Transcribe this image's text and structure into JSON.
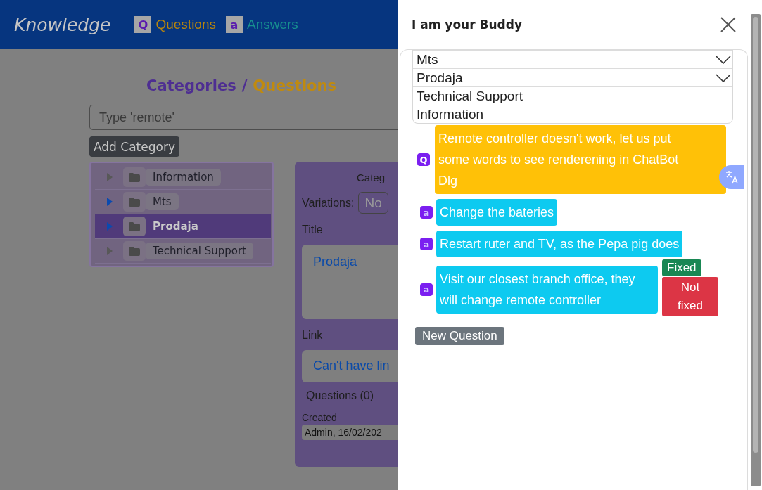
{
  "navbar": {
    "brand": "Knowledge",
    "links": [
      {
        "kind": "questions",
        "badge": "Q",
        "label": "Questions"
      },
      {
        "kind": "answers",
        "badge": "a",
        "label": "Answers"
      }
    ]
  },
  "page": {
    "title_part_1": "Categories",
    "title_separator": "/",
    "title_part_2": "Questions",
    "search": {
      "placeholder": "Type 'remote'"
    },
    "add_button": "Add Category",
    "tree": [
      {
        "label": "Information",
        "expandable": false,
        "selected": false
      },
      {
        "label": "Mts",
        "expandable": true,
        "selected": false
      },
      {
        "label": "Prodaja",
        "expandable": true,
        "selected": true
      },
      {
        "label": "Technical Support",
        "expandable": false,
        "selected": false
      }
    ],
    "detail": {
      "heading": "Categ",
      "variations_label": "Variations:",
      "variations_button": "No",
      "title_label": "Title",
      "title_value": "Prodaja",
      "link_label": "Link",
      "link_value": "Can't have lin",
      "questions_label": "Questions (0)",
      "created_label": "Created",
      "created_value": "Admin, 16/02/202"
    }
  },
  "buddy": {
    "title": "I am your Buddy",
    "categories": [
      {
        "label": "Mts",
        "expandable": true
      },
      {
        "label": "Prodaja",
        "expandable": true
      },
      {
        "label": "Technical Support",
        "expandable": false
      },
      {
        "label": "Information",
        "expandable": false
      }
    ],
    "messages": [
      {
        "kind": "question",
        "badge": "Q",
        "text": "Remote controller doesn't work, let us put some words to see renderening in ChatBot Dlg"
      },
      {
        "kind": "answer",
        "badge": "a",
        "text": "Change the bateries"
      },
      {
        "kind": "answer",
        "badge": "a",
        "text": "Restart ruter and TV, as the Pepa pig does"
      },
      {
        "kind": "answer",
        "badge": "a",
        "text": "Visit our closest branch office, they will change remote controller",
        "actions": [
          {
            "kind": "success",
            "label": "Fixed"
          },
          {
            "kind": "danger",
            "label": "Not fixed"
          }
        ]
      }
    ],
    "new_button": "New Question"
  }
}
